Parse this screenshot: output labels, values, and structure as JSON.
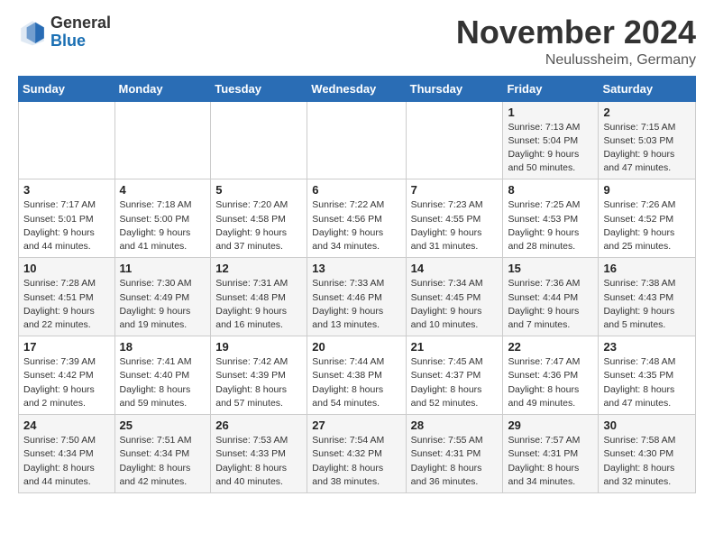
{
  "logo": {
    "general": "General",
    "blue": "Blue"
  },
  "header": {
    "month": "November 2024",
    "location": "Neulussheim, Germany"
  },
  "days_of_week": [
    "Sunday",
    "Monday",
    "Tuesday",
    "Wednesday",
    "Thursday",
    "Friday",
    "Saturday"
  ],
  "weeks": [
    [
      {
        "day": "",
        "info": ""
      },
      {
        "day": "",
        "info": ""
      },
      {
        "day": "",
        "info": ""
      },
      {
        "day": "",
        "info": ""
      },
      {
        "day": "",
        "info": ""
      },
      {
        "day": "1",
        "info": "Sunrise: 7:13 AM\nSunset: 5:04 PM\nDaylight: 9 hours\nand 50 minutes."
      },
      {
        "day": "2",
        "info": "Sunrise: 7:15 AM\nSunset: 5:03 PM\nDaylight: 9 hours\nand 47 minutes."
      }
    ],
    [
      {
        "day": "3",
        "info": "Sunrise: 7:17 AM\nSunset: 5:01 PM\nDaylight: 9 hours\nand 44 minutes."
      },
      {
        "day": "4",
        "info": "Sunrise: 7:18 AM\nSunset: 5:00 PM\nDaylight: 9 hours\nand 41 minutes."
      },
      {
        "day": "5",
        "info": "Sunrise: 7:20 AM\nSunset: 4:58 PM\nDaylight: 9 hours\nand 37 minutes."
      },
      {
        "day": "6",
        "info": "Sunrise: 7:22 AM\nSunset: 4:56 PM\nDaylight: 9 hours\nand 34 minutes."
      },
      {
        "day": "7",
        "info": "Sunrise: 7:23 AM\nSunset: 4:55 PM\nDaylight: 9 hours\nand 31 minutes."
      },
      {
        "day": "8",
        "info": "Sunrise: 7:25 AM\nSunset: 4:53 PM\nDaylight: 9 hours\nand 28 minutes."
      },
      {
        "day": "9",
        "info": "Sunrise: 7:26 AM\nSunset: 4:52 PM\nDaylight: 9 hours\nand 25 minutes."
      }
    ],
    [
      {
        "day": "10",
        "info": "Sunrise: 7:28 AM\nSunset: 4:51 PM\nDaylight: 9 hours\nand 22 minutes."
      },
      {
        "day": "11",
        "info": "Sunrise: 7:30 AM\nSunset: 4:49 PM\nDaylight: 9 hours\nand 19 minutes."
      },
      {
        "day": "12",
        "info": "Sunrise: 7:31 AM\nSunset: 4:48 PM\nDaylight: 9 hours\nand 16 minutes."
      },
      {
        "day": "13",
        "info": "Sunrise: 7:33 AM\nSunset: 4:46 PM\nDaylight: 9 hours\nand 13 minutes."
      },
      {
        "day": "14",
        "info": "Sunrise: 7:34 AM\nSunset: 4:45 PM\nDaylight: 9 hours\nand 10 minutes."
      },
      {
        "day": "15",
        "info": "Sunrise: 7:36 AM\nSunset: 4:44 PM\nDaylight: 9 hours\nand 7 minutes."
      },
      {
        "day": "16",
        "info": "Sunrise: 7:38 AM\nSunset: 4:43 PM\nDaylight: 9 hours\nand 5 minutes."
      }
    ],
    [
      {
        "day": "17",
        "info": "Sunrise: 7:39 AM\nSunset: 4:42 PM\nDaylight: 9 hours\nand 2 minutes."
      },
      {
        "day": "18",
        "info": "Sunrise: 7:41 AM\nSunset: 4:40 PM\nDaylight: 8 hours\nand 59 minutes."
      },
      {
        "day": "19",
        "info": "Sunrise: 7:42 AM\nSunset: 4:39 PM\nDaylight: 8 hours\nand 57 minutes."
      },
      {
        "day": "20",
        "info": "Sunrise: 7:44 AM\nSunset: 4:38 PM\nDaylight: 8 hours\nand 54 minutes."
      },
      {
        "day": "21",
        "info": "Sunrise: 7:45 AM\nSunset: 4:37 PM\nDaylight: 8 hours\nand 52 minutes."
      },
      {
        "day": "22",
        "info": "Sunrise: 7:47 AM\nSunset: 4:36 PM\nDaylight: 8 hours\nand 49 minutes."
      },
      {
        "day": "23",
        "info": "Sunrise: 7:48 AM\nSunset: 4:35 PM\nDaylight: 8 hours\nand 47 minutes."
      }
    ],
    [
      {
        "day": "24",
        "info": "Sunrise: 7:50 AM\nSunset: 4:34 PM\nDaylight: 8 hours\nand 44 minutes."
      },
      {
        "day": "25",
        "info": "Sunrise: 7:51 AM\nSunset: 4:34 PM\nDaylight: 8 hours\nand 42 minutes."
      },
      {
        "day": "26",
        "info": "Sunrise: 7:53 AM\nSunset: 4:33 PM\nDaylight: 8 hours\nand 40 minutes."
      },
      {
        "day": "27",
        "info": "Sunrise: 7:54 AM\nSunset: 4:32 PM\nDaylight: 8 hours\nand 38 minutes."
      },
      {
        "day": "28",
        "info": "Sunrise: 7:55 AM\nSunset: 4:31 PM\nDaylight: 8 hours\nand 36 minutes."
      },
      {
        "day": "29",
        "info": "Sunrise: 7:57 AM\nSunset: 4:31 PM\nDaylight: 8 hours\nand 34 minutes."
      },
      {
        "day": "30",
        "info": "Sunrise: 7:58 AM\nSunset: 4:30 PM\nDaylight: 8 hours\nand 32 minutes."
      }
    ]
  ]
}
